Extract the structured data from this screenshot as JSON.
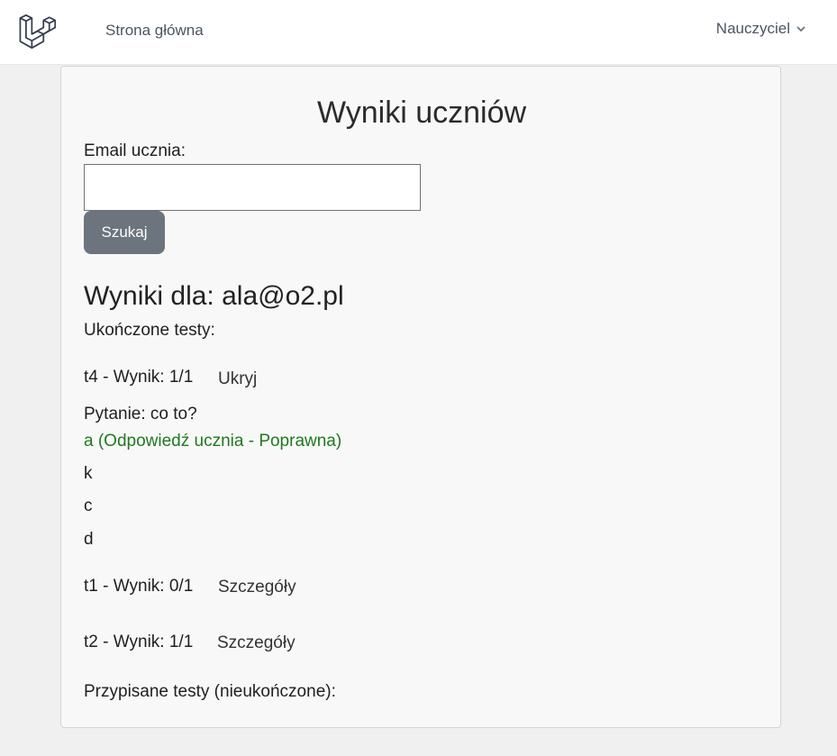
{
  "nav": {
    "home_label": "Strona główna",
    "user_label": "Nauczyciel"
  },
  "page": {
    "title": "Wyniki uczniów",
    "email_label": "Email ucznia:",
    "email_value": "",
    "search_button": "Szukaj",
    "results_heading": "Wyniki dla: ala@o2.pl",
    "completed_label": "Ukończone testy:",
    "assigned_label": "Przypisane testy (nieukończone):"
  },
  "completed_tests": [
    {
      "title": "t4 - Wynik: 1/1",
      "link": "Ukryj",
      "question": "Pytanie: co to?",
      "correct_answer": "a (Odpowiedź ucznia - Poprawna)",
      "options": [
        "k",
        "c",
        "d"
      ]
    },
    {
      "title": "t1 - Wynik: 0/1",
      "link": "Szczegóły"
    },
    {
      "title": "t2 - Wynik: 1/1",
      "link": "Szczegóły"
    }
  ],
  "colors": {
    "button_bg": "#6c757d",
    "correct_answer": "#1f7a1f",
    "background": "#f0f0f0"
  }
}
